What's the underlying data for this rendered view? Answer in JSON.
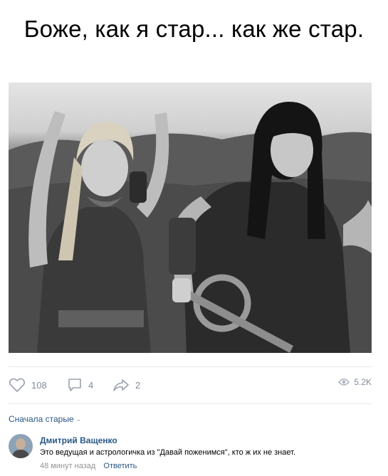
{
  "post": {
    "caption": "Боже, как я стар... как же стар."
  },
  "actions": {
    "likes": "108",
    "comments": "4",
    "shares": "2",
    "views": "5.2K"
  },
  "comments_section": {
    "sort_label": "Сначала старые"
  },
  "comment": {
    "author": "Дмитрий Ващенко",
    "text": "Это ведущая и астрологичка из \"Давай поженимся\", кто ж их не знает.",
    "time": "48 минут назад",
    "reply_label": "Ответить"
  },
  "colors": {
    "link": "#2a5885",
    "muted": "#818c99",
    "divider": "#e7e8ec"
  }
}
